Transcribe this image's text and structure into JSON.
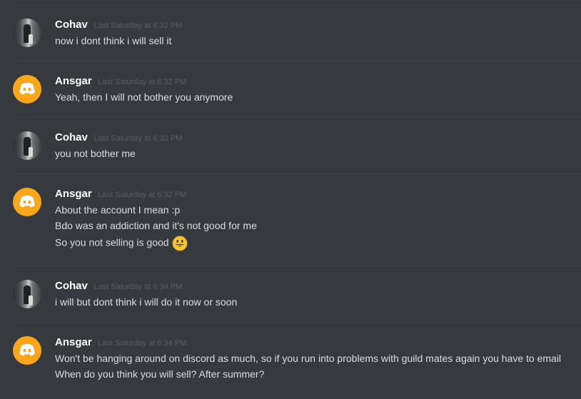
{
  "messages": [
    {
      "author": "Cohav",
      "avatar": "photo-avatar",
      "timestamp": "Last Saturday at 6:32 PM",
      "lines": [
        "now i dont think i will sell it"
      ]
    },
    {
      "author": "Ansgar",
      "avatar": "discord-logo-avatar",
      "timestamp": "Last Saturday at 6:32 PM",
      "lines": [
        "Yeah, then I will not bother you anymore"
      ]
    },
    {
      "author": "Cohav",
      "avatar": "photo-avatar",
      "timestamp": "Last Saturday at 6:32 PM",
      "lines": [
        "you not bother me"
      ]
    },
    {
      "author": "Ansgar",
      "avatar": "discord-logo-avatar",
      "timestamp": "Last Saturday at 6:32 PM",
      "lines": [
        "About the account I mean :p",
        "Bdo was an addiction and it's not good for me",
        "So you not selling is good"
      ],
      "emoji": "smiley-emoji"
    },
    {
      "author": "Cohav",
      "avatar": "photo-avatar",
      "timestamp": "Last Saturday at 6:34 PM",
      "lines": [
        "i will but dont think i will do it now or soon"
      ]
    },
    {
      "author": "Ansgar",
      "avatar": "discord-logo-avatar",
      "timestamp": "Last Saturday at 6:34 PM",
      "lines": [
        "Won't be hanging around on discord as much, so if you run into problems with guild mates again you have to email",
        "When do you think you will sell? After summer?"
      ]
    }
  ],
  "colors": {
    "background": "#36393e",
    "divider": "#3e4147",
    "username": "#ffffff",
    "timestamp": "#5b5e62",
    "message_text": "#dcddde",
    "discord_avatar_bg": "#faa61a",
    "emoji_face": "#f7c531"
  }
}
